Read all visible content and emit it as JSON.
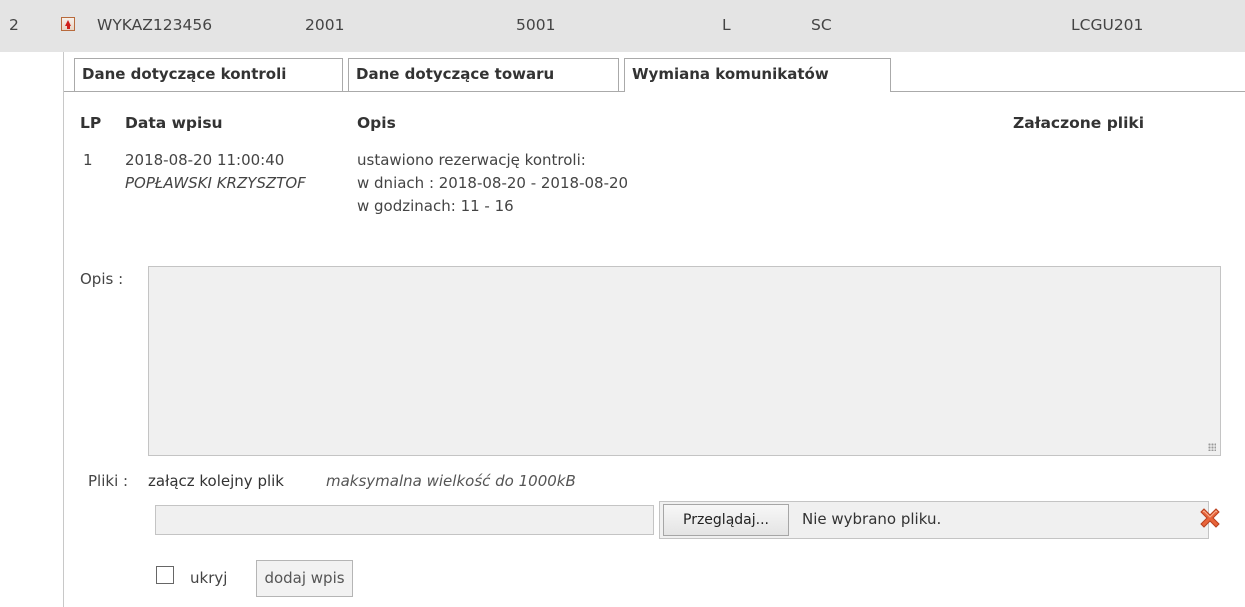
{
  "record_row": {
    "number": "2",
    "id": "WYKAZ123456",
    "col1": "2001",
    "col2": "5001",
    "col3": "L",
    "col4": "SC",
    "col5": "LCGU201"
  },
  "tabs": [
    {
      "label": "Dane dotyczące kontroli",
      "active": false
    },
    {
      "label": "Dane dotyczące towaru",
      "active": false
    },
    {
      "label": "Wymiana komunikatów",
      "active": true
    }
  ],
  "table": {
    "headers": {
      "lp": "LP",
      "date": "Data wpisu",
      "description": "Opis",
      "files": "Załaczone pliki"
    },
    "rows": [
      {
        "lp": "1",
        "date": "2018-08-20 11:00:40",
        "author": "POPŁAWSKI KRZYSZTOF",
        "description_lines": [
          "ustawiono rezerwację kontroli:",
          "w dniach : 2018-08-20 - 2018-08-20",
          "w godzinach: 11 - 16"
        ],
        "files": ""
      }
    ]
  },
  "form": {
    "description_label": "Opis :",
    "description_value": "",
    "files_label": "Pliki :",
    "attach_link": "załącz kolejny plik",
    "max_size_note": "maksymalna wielkość do 1000kB",
    "browse_button": "Przeglądaj...",
    "no_file_text": "Nie wybrano pliku.",
    "hide_label": "ukryj",
    "hide_checked": false,
    "add_button": "dodaj wpis"
  },
  "icons": {
    "expand": "arrow-up-icon",
    "remove_file": "remove-x-icon"
  },
  "colors": {
    "row_background": "#e4e4e4",
    "input_background": "#f0f0f0",
    "remove_icon": "#e8643a"
  }
}
